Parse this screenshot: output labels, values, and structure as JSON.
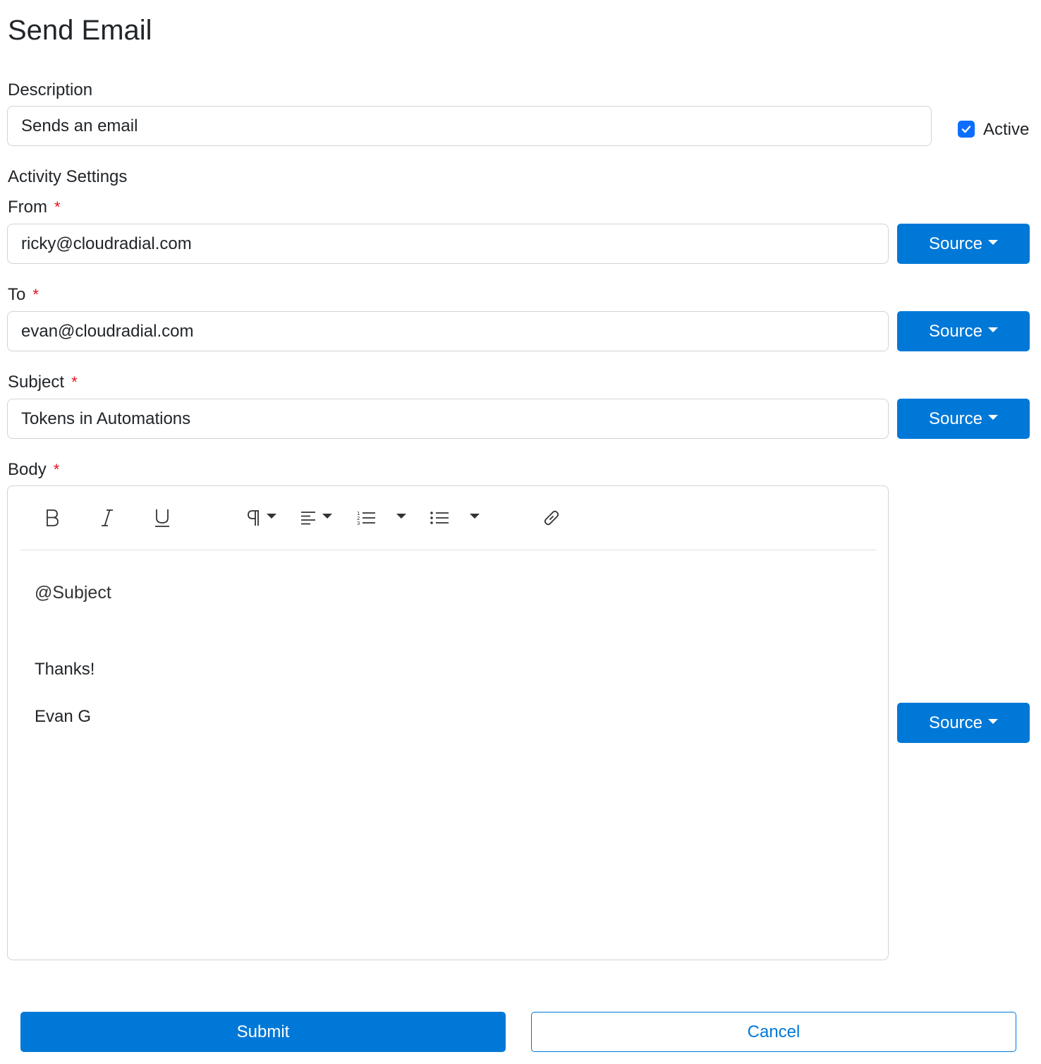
{
  "page": {
    "title": "Send Email"
  },
  "description": {
    "label": "Description",
    "value": "Sends an email"
  },
  "active": {
    "label": "Active",
    "checked": true
  },
  "activity_settings": {
    "heading": "Activity Settings"
  },
  "fields": {
    "from": {
      "label": "From",
      "required": "*",
      "value": "ricky@cloudradial.com",
      "source_label": "Source"
    },
    "to": {
      "label": "To",
      "required": "*",
      "value": "evan@cloudradial.com",
      "source_label": "Source"
    },
    "subject": {
      "label": "Subject",
      "required": "*",
      "value": "Tokens in Automations",
      "source_label": "Source"
    }
  },
  "body": {
    "label": "Body",
    "required": "*",
    "source_label": "Source",
    "toolbar": [
      "bold-icon",
      "italic-icon",
      "underline-icon",
      "paragraph-icon",
      "align-left-icon",
      "ordered-list-icon",
      "unordered-list-icon",
      "link-icon"
    ],
    "content": {
      "line1": "@Subject",
      "line2": "Thanks!",
      "line3": "Evan G"
    }
  },
  "actions": {
    "submit_label": "Submit",
    "cancel_label": "Cancel"
  },
  "colors": {
    "primary": "#0078d7",
    "required": "#e3101e",
    "checkbox": "#0d6efd",
    "border": "#ced4da"
  }
}
